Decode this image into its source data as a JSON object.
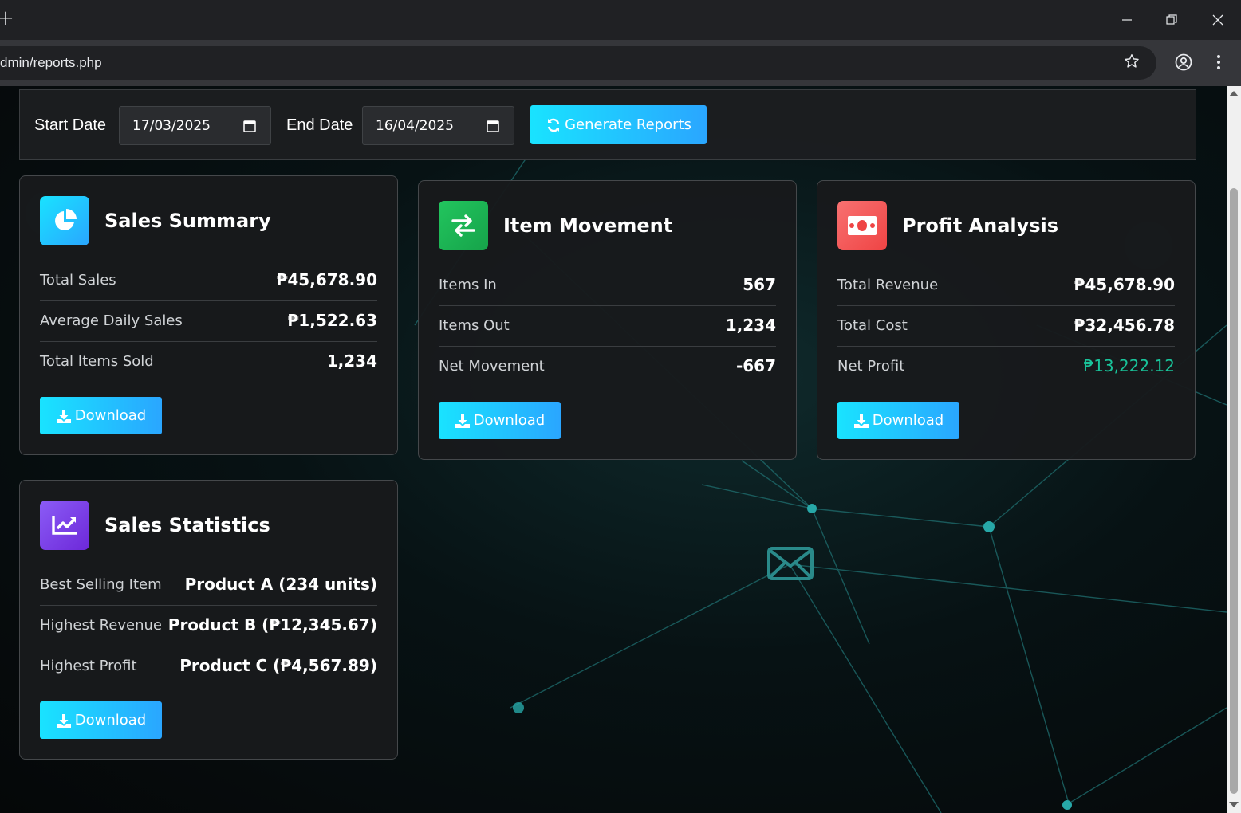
{
  "browser": {
    "new_tab": "+",
    "url": "dmin/reports.php"
  },
  "filters": {
    "start_label": "Start Date",
    "start_value": "17/03/2025",
    "end_label": "End Date",
    "end_value": "16/04/2025",
    "generate_label": "Generate Reports"
  },
  "cards": {
    "sales_summary": {
      "title": "Sales Summary",
      "rows": [
        {
          "label": "Total Sales",
          "value": "₱45,678.90"
        },
        {
          "label": "Average Daily Sales",
          "value": "₱1,522.63"
        },
        {
          "label": "Total Items Sold",
          "value": "1,234"
        }
      ],
      "download": "Download"
    },
    "item_movement": {
      "title": "Item Movement",
      "rows": [
        {
          "label": "Items In",
          "value": "567"
        },
        {
          "label": "Items Out",
          "value": "1,234"
        },
        {
          "label": "Net Movement",
          "value": "-667"
        }
      ],
      "download": "Download"
    },
    "profit_analysis": {
      "title": "Profit Analysis",
      "rows": [
        {
          "label": "Total Revenue",
          "value": "₱45,678.90"
        },
        {
          "label": "Total Cost",
          "value": "₱32,456.78"
        },
        {
          "label": "Net Profit",
          "value": "₱13,222.12"
        }
      ],
      "download": "Download"
    },
    "sales_statistics": {
      "title": "Sales Statistics",
      "rows": [
        {
          "label": "Best Selling Item",
          "value": "Product A (234 units)"
        },
        {
          "label": "Highest Revenue",
          "value": "Product B (₱12,345.67)"
        },
        {
          "label": "Highest Profit",
          "value": "Product C (₱4,567.89)"
        }
      ],
      "download": "Download"
    }
  },
  "colors": {
    "accent_cyan": "#19e3ff",
    "accent_blue": "#2aa6ff",
    "profit_green": "#19c39a",
    "icon_movement": "#22c55e",
    "icon_profit": "#ef4444",
    "icon_statistics": "#7c3aed"
  }
}
